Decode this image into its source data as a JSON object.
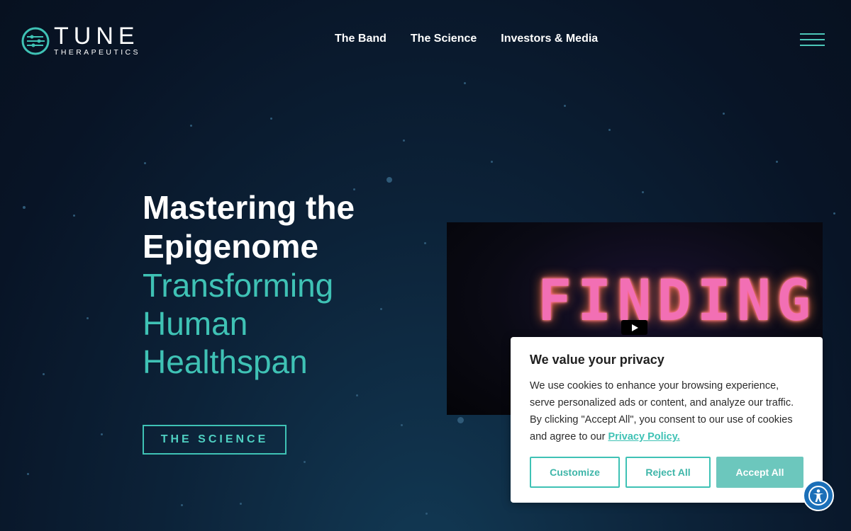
{
  "brand": {
    "name": "TUNE",
    "subtitle": "THERAPEUTICS"
  },
  "nav": {
    "items": [
      "The Band",
      "The Science",
      "Investors & Media"
    ]
  },
  "hero": {
    "title_lines": [
      "Mastering the",
      "Epigenome"
    ],
    "subtitle_lines": [
      "Transforming",
      "Human",
      "Healthspan"
    ],
    "cta_label": "THE SCIENCE"
  },
  "video": {
    "overlay_text": "FINDING"
  },
  "cookie": {
    "title": "We value your privacy",
    "body": "We use cookies to enhance your browsing experience, serve personalized ads or content, and analyze our traffic. By clicking \"Accept All\", you consent to our use of cookies and agree to our ",
    "policy_link": "Privacy Policy.",
    "customize_label": "Customize",
    "reject_label": "Reject All",
    "accept_label": "Accept All"
  },
  "colors": {
    "accent": "#3fc2b5",
    "background": "#0c2238",
    "accessibility": "#1b6fb8"
  },
  "icons": [
    "tune-logo-icon",
    "hamburger-menu-icon",
    "play-icon",
    "accessibility-icon"
  ]
}
